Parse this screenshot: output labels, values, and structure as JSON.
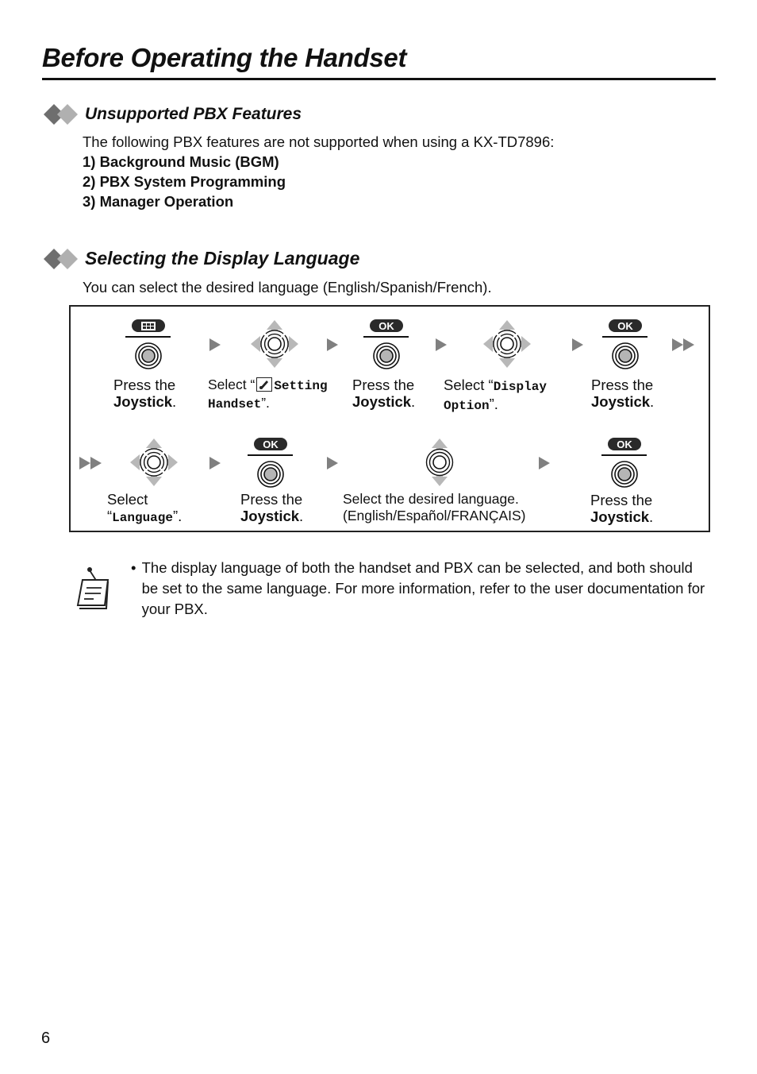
{
  "page": {
    "title": "Before Operating the Handset",
    "page_number": "6"
  },
  "sections": [
    {
      "title": "Unsupported PBX Features",
      "intro": "The following PBX features are not supported when using a KX-TD7896:",
      "items": [
        "1) Background Music (BGM)",
        "2) PBX System Programming",
        "3) Manager Operation"
      ]
    },
    {
      "title": "Selecting the Display Language",
      "intro": "You can select the desired language (English/Spanish/French)."
    }
  ],
  "flow": {
    "icons": {
      "menu_button": "menu-grid-icon",
      "ok_button": "OK",
      "joystick_press": "joystick-press-icon",
      "joystick_4way": "joystick-4way-icon",
      "joystick_updown": "joystick-updown-icon",
      "setting_glyph": "setting-handset-icon"
    },
    "row1": [
      {
        "l1": "Press the",
        "l2": "Joystick",
        "tail": "."
      },
      {
        "pre": "Select “",
        "code1": "Setting",
        "code2": "Handset",
        "post": "”."
      },
      {
        "l1": "Press the",
        "l2": "Joystick",
        "tail": "."
      },
      {
        "pre": "Select “",
        "code1": "Display",
        "code2": "Option",
        "post": "”."
      },
      {
        "l1": "Press the",
        "l2": "Joystick",
        "tail": "."
      }
    ],
    "row2": [
      {
        "pre": "Select",
        "open": "“",
        "code": "Language",
        "post": "”."
      },
      {
        "l1": "Press the",
        "l2": "Joystick",
        "tail": "."
      },
      {
        "l1": "Select the desired language.",
        "l2": "(English/Español/FRANÇAIS)"
      },
      {
        "l1": "Press the",
        "l2": "Joystick",
        "tail": "."
      }
    ]
  },
  "note": {
    "icon": "note-pad-icon",
    "bullet": "•",
    "text": "The display language of both the handset and PBX can be selected, and both should be set to the same language. For more information, refer to the user documentation for your PBX."
  }
}
